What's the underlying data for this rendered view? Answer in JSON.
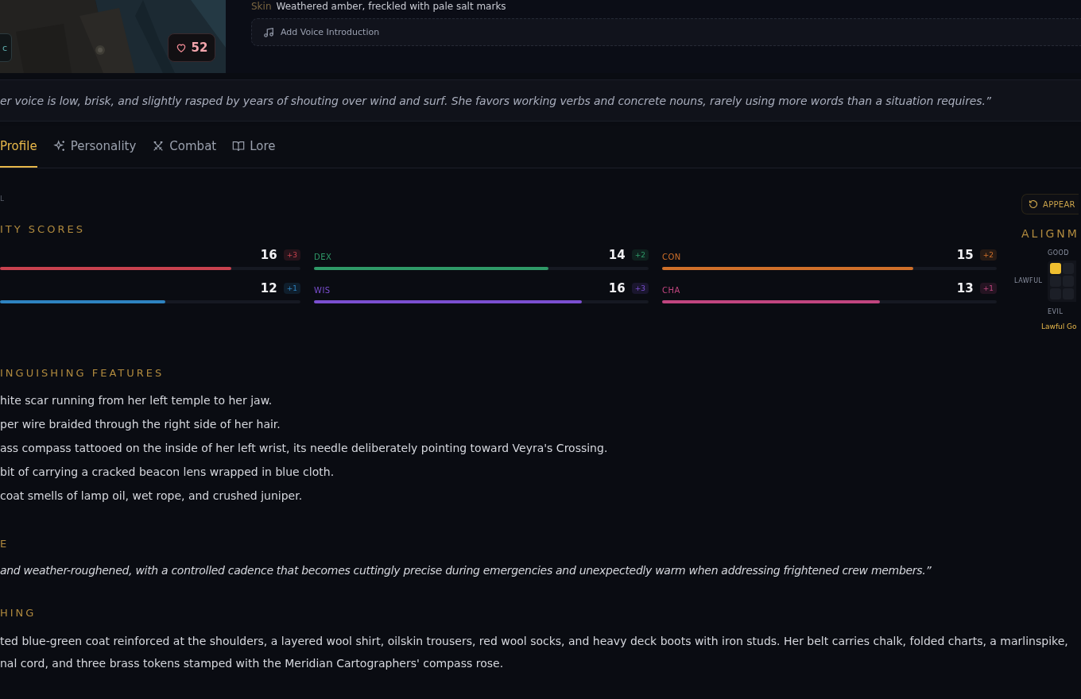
{
  "header": {
    "likes": "52",
    "side_badge": "c",
    "skin": {
      "label": "Skin",
      "value": "Weathered amber, freckled with pale salt marks"
    },
    "voice_button": "Add Voice Introduction"
  },
  "quote": "er voice is low, brisk, and slightly rasped by years of shouting over wind and surf. She favors working verbs and concrete nouns, rarely using more words than a situation requires.”",
  "tabs": [
    {
      "label": "Profile",
      "selected": true
    },
    {
      "label": "Personality",
      "selected": false
    },
    {
      "label": "Combat",
      "selected": false
    },
    {
      "label": "Lore",
      "selected": false
    }
  ],
  "overline": "L",
  "appearance_button": "APPEAR",
  "scores": {
    "title": "ITY SCORES",
    "stats": [
      {
        "value": "16",
        "mod": "+3",
        "color": "#c9424f",
        "level": 0.77
      },
      {
        "label": "DEX",
        "value": "14",
        "mod": "+2",
        "color": "#2f9a68",
        "level": 0.7
      },
      {
        "label": "CON",
        "value": "15",
        "mod": "+2",
        "color": "#d0702a",
        "level": 0.75
      },
      {
        "value": "12",
        "mod": "+1",
        "color": "#2e83c0",
        "level": 0.55
      },
      {
        "label": "WIS",
        "value": "16",
        "mod": "+3",
        "color": "#7a4fd0",
        "level": 0.8
      },
      {
        "label": "CHA",
        "value": "13",
        "mod": "+1",
        "color": "#c0457f",
        "level": 0.65
      }
    ]
  },
  "alignment": {
    "title": "ALIGNM",
    "top": "GOOD",
    "left": "LAWFUL",
    "bottom": "EVIL",
    "result": "Lawful Go",
    "cells": [
      {
        "selected": true
      },
      {
        "selected": false
      },
      {
        "selected": false
      },
      {
        "selected": false
      },
      {
        "selected": false
      },
      {
        "selected": false
      }
    ]
  },
  "features": {
    "title": "INGUISHING FEATURES",
    "items": [
      "hite scar running from her left temple to her jaw.",
      "per wire braided through the right side of her hair.",
      "ass compass tattooed on the inside of her left wrist, its needle deliberately pointing toward Veyra's Crossing.",
      "bit of carrying a cracked beacon lens wrapped in blue cloth.",
      "coat smells of lamp oil, wet rope, and crushed juniper."
    ]
  },
  "voice": {
    "title": "E",
    "text": "and weather-roughened, with a controlled cadence that becomes cuttingly precise during emergencies and unexpectedly warm when addressing frightened crew members.”"
  },
  "clothing": {
    "title": "HING",
    "text": "ted blue-green coat reinforced at the shoulders, a layered wool shirt, oilskin trousers, red wool socks, and heavy deck boots with iron studs. Her belt carries chalk, folded charts, a marlinspike, nal cord, and three brass tokens stamped with the Meridian Cartographers' compass rose."
  }
}
